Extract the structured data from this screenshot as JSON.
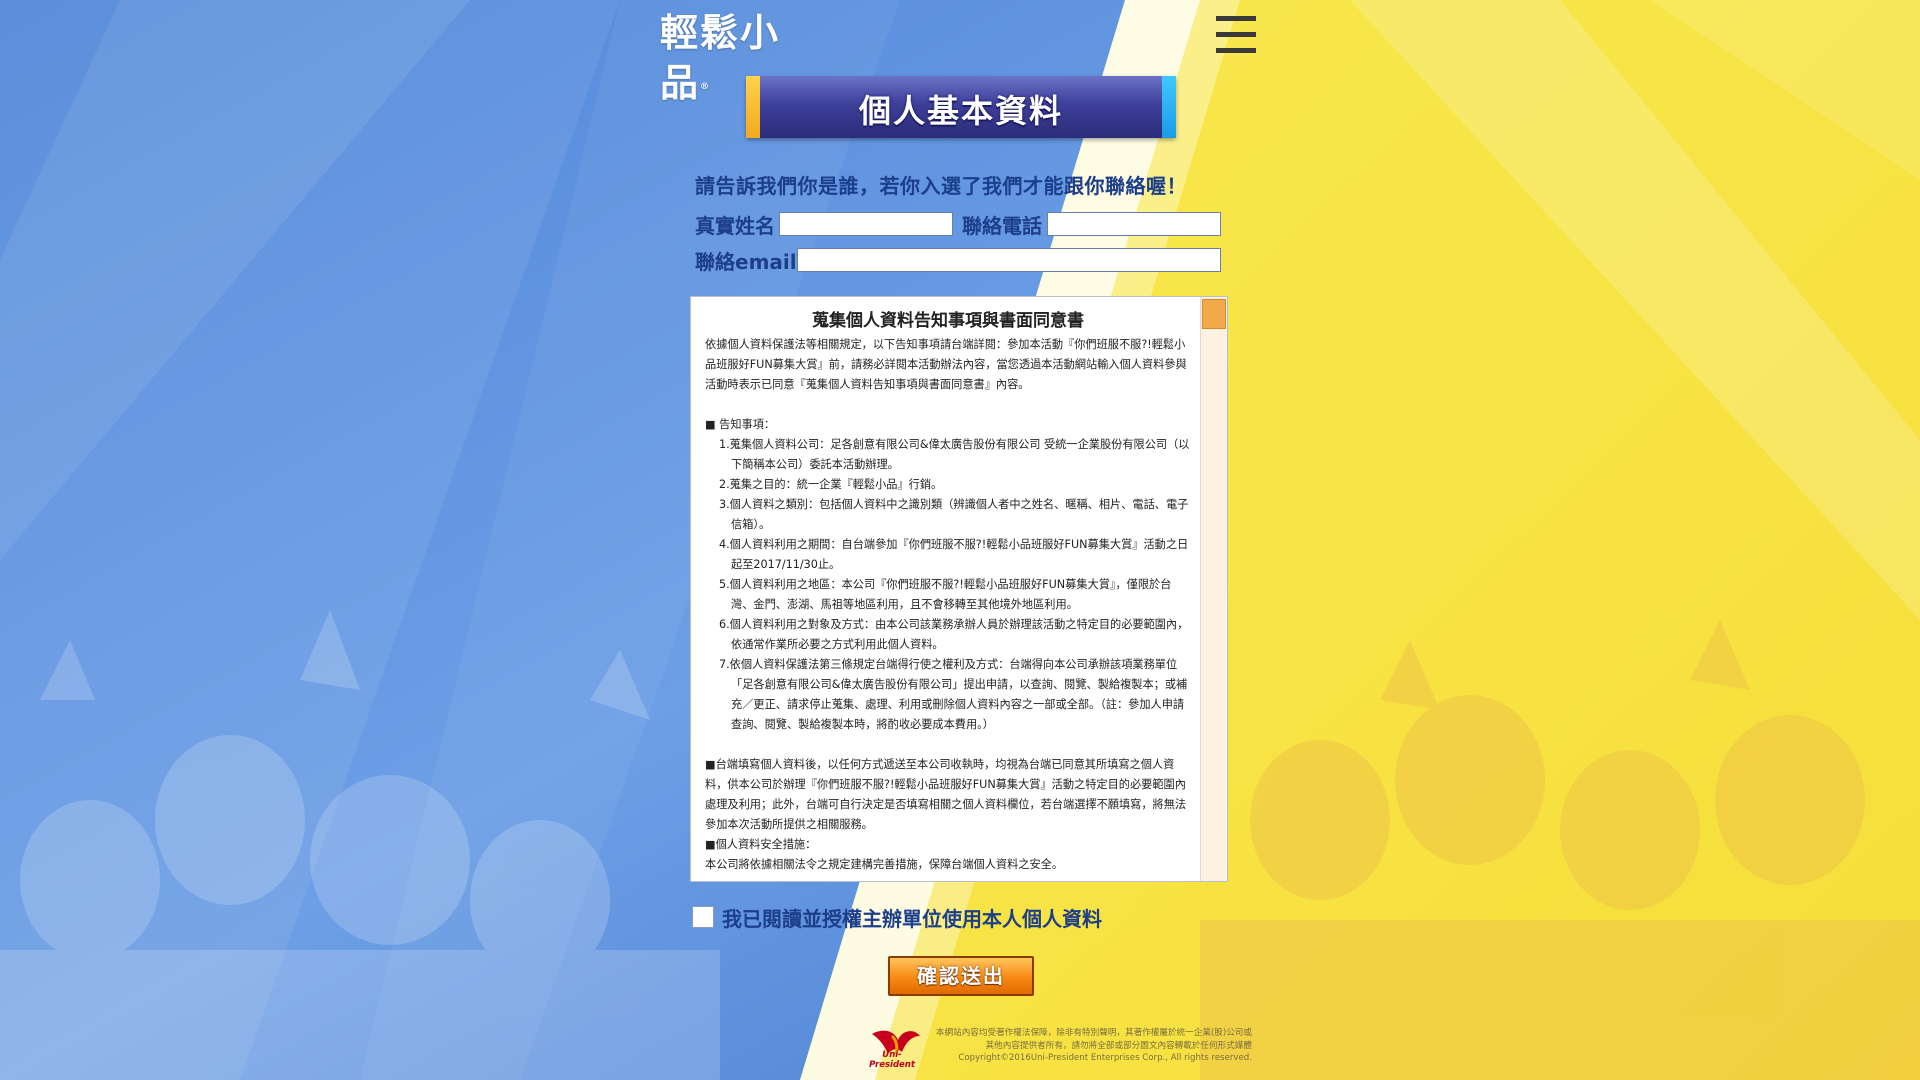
{
  "header": {
    "logo_text": "輕鬆小品",
    "logo_mark": "®",
    "menu_icon": "hamburger-menu-icon"
  },
  "banner": {
    "title": "個人基本資料"
  },
  "form": {
    "prompt": "請告訴我們你是誰，若你入選了我們才能跟你聯絡喔！",
    "name_label": "真實姓名",
    "name_value": "",
    "phone_label": "聯絡電話",
    "phone_value": "",
    "email_label": "聯絡email",
    "email_value": ""
  },
  "agreement": {
    "title": "蒐集個人資料告知事項與書面同意書",
    "intro": "依據個人資料保護法等相關規定，以下告知事項請台端詳閱：參加本活動『你們班服不服?!輕鬆小品班服好FUN募集大賞』前，請務必詳閱本活動辦法內容，當您透過本活動網站輸入個人資料參與活動時表示已同意『蒐集個人資料告知事項與書面同意書』內容。",
    "notice_heading": "■ 告知事項：",
    "items": [
      "1.蒐集個人資料公司：足各創意有限公司&偉太廣告股份有限公司 受統一企業股份有限公司（以下簡稱本公司）委託本活動辦理。",
      "2.蒐集之目的：統一企業『輕鬆小品』行銷。",
      "3.個人資料之類別：包括個人資料中之識別類（辨識個人者中之姓名、暱稱、相片、電話、電子信箱）。",
      "4.個人資料利用之期間：自台端參加『你們班服不服?!輕鬆小品班服好FUN募集大賞』活動之日起至2017/11/30止。",
      "5.個人資料利用之地區：本公司『你們班服不服?!輕鬆小品班服好FUN募集大賞』，僅限於台灣、金門、澎湖、馬祖等地區利用，且不會移轉至其他境外地區利用。",
      "6.個人資料利用之對象及方式：由本公司該業務承辦人員於辦理該活動之特定目的必要範圍內，依通常作業所必要之方式利用此個人資料。",
      "7.依個人資料保護法第三條規定台端得行使之權利及方式：台端得向本公司承辦該項業務單位「足各創意有限公司&偉太廣告股份有限公司」提出申請，以查詢、閱覽、製給複製本；或補充／更正、請求停止蒐集、處理、利用或刪除個人資料內容之一部或全部。（註：參加人申請查詢、閱覽、製給複製本時，將酌收必要成本費用。）"
    ],
    "consent_para": "■台端填寫個人資料後，以任何方式遞送至本公司收執時，均視為台端已同意其所填寫之個人資料，供本公司於辦理『你們班服不服?!輕鬆小品班服好FUN募集大賞』活動之特定目的必要範圍內處理及利用；此外，台端可自行決定是否填寫相關之個人資料欄位，若台端選擇不願填寫，將無法參加本次活動所提供之相關服務。",
    "security_heading": "■個人資料安全措施：",
    "security_text": "本公司將依據相關法令之規定建構完善措施，保障台端個人資料之安全。"
  },
  "consent": {
    "checked": false,
    "label": "我已閱讀並授權主辦單位使用本人個人資料"
  },
  "submit": {
    "label": "確認送出"
  },
  "footer": {
    "brand": "Uni-President",
    "line1": "本網站內容均受著作權法保障，除非有特別聲明，其著作權屬於統一企業(股)公司或",
    "line2": "其他內容提供者所有，請勿將全部或部分圖文內容轉載於任何形式媒體",
    "line3": "Copyright©2016Uni-President Enterprises Corp., All rights reserved."
  },
  "colors": {
    "blue_bg": "#5b8fdc",
    "yellow_bg": "#f7e54a",
    "label_text": "#1d3f8a",
    "banner_purple": "#3e3f9a",
    "submit_orange": "#f68a12"
  }
}
